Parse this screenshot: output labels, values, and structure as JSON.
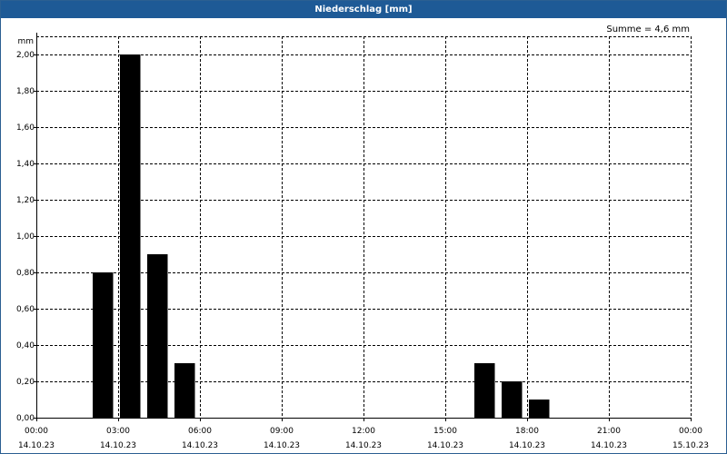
{
  "window": {
    "title": "Niederschlag [mm]"
  },
  "summary": {
    "text": "Summe = 4,6 mm"
  },
  "colors": {
    "titlebar": "#1e5a96",
    "bars": "#000000",
    "grid": "#000000"
  },
  "chart_data": {
    "type": "bar",
    "title": "Niederschlag [mm]",
    "ylabel": "mm",
    "xlabel": "",
    "ylim": [
      0,
      2.1
    ],
    "grid": true,
    "legend": "none",
    "bar_width_hours": 0.75,
    "x_ticks": [
      {
        "hour": 0,
        "time": "00:00",
        "date": "14.10.23"
      },
      {
        "hour": 3,
        "time": "03:00",
        "date": "14.10.23"
      },
      {
        "hour": 6,
        "time": "06:00",
        "date": "14.10.23"
      },
      {
        "hour": 9,
        "time": "09:00",
        "date": "14.10.23"
      },
      {
        "hour": 12,
        "time": "12:00",
        "date": "14.10.23"
      },
      {
        "hour": 15,
        "time": "15:00",
        "date": "14.10.23"
      },
      {
        "hour": 18,
        "time": "18:00",
        "date": "14.10.23"
      },
      {
        "hour": 21,
        "time": "21:00",
        "date": "14.10.23"
      },
      {
        "hour": 24,
        "time": "00:00",
        "date": "15.10.23"
      }
    ],
    "y_ticks": [
      {
        "value": 0.0,
        "label": "0,00"
      },
      {
        "value": 0.2,
        "label": "0,20"
      },
      {
        "value": 0.4,
        "label": "0,40"
      },
      {
        "value": 0.6,
        "label": "0,60"
      },
      {
        "value": 0.8,
        "label": "0,80"
      },
      {
        "value": 1.0,
        "label": "1,00"
      },
      {
        "value": 1.2,
        "label": "1,20"
      },
      {
        "value": 1.4,
        "label": "1,40"
      },
      {
        "value": 1.6,
        "label": "1,60"
      },
      {
        "value": 1.8,
        "label": "1,80"
      },
      {
        "value": 2.0,
        "label": "2,00"
      }
    ],
    "bars": [
      {
        "start_hour": 2,
        "value": 0.8
      },
      {
        "start_hour": 3,
        "value": 2.0
      },
      {
        "start_hour": 4,
        "value": 0.9
      },
      {
        "start_hour": 5,
        "value": 0.3
      },
      {
        "start_hour": 16,
        "value": 0.3
      },
      {
        "start_hour": 17,
        "value": 0.2
      },
      {
        "start_hour": 18,
        "value": 0.1
      }
    ]
  }
}
